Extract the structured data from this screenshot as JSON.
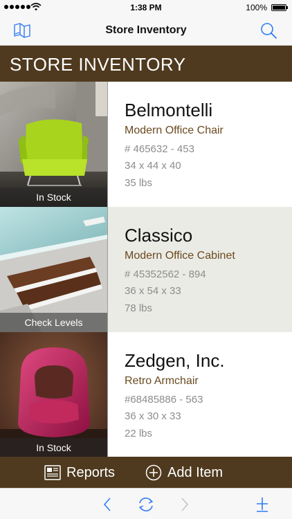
{
  "status_bar": {
    "time": "1:38 PM",
    "battery": "100%"
  },
  "nav": {
    "title": "Store Inventory"
  },
  "section": {
    "title": "STORE INVENTORY"
  },
  "items": [
    {
      "name": "Belmontelli",
      "model": "Modern Office Chair",
      "sku": "# 465632 - 453",
      "dims": "34 x 44 x 40",
      "weight": "35 lbs",
      "stock": "In Stock"
    },
    {
      "name": "Classico",
      "model": "Modern Office Cabinet",
      "sku": "# 45352562 - 894",
      "dims": "36 x 54 x 33",
      "weight": "78 lbs",
      "stock": "Check Levels"
    },
    {
      "name": "Zedgen, Inc.",
      "model": "Retro Armchair",
      "sku": "#68485886 - 563",
      "dims": "36 x 30  x 33",
      "weight": "22 lbs",
      "stock": "In Stock"
    }
  ],
  "toolbar": {
    "reports_label": "Reports",
    "add_label": "Add Item"
  },
  "colors": {
    "brand_brown": "#4f3a1f",
    "model_text": "#6a4a1f",
    "ios_blue": "#2f7cf6",
    "selected_row": "#ebebe6"
  }
}
